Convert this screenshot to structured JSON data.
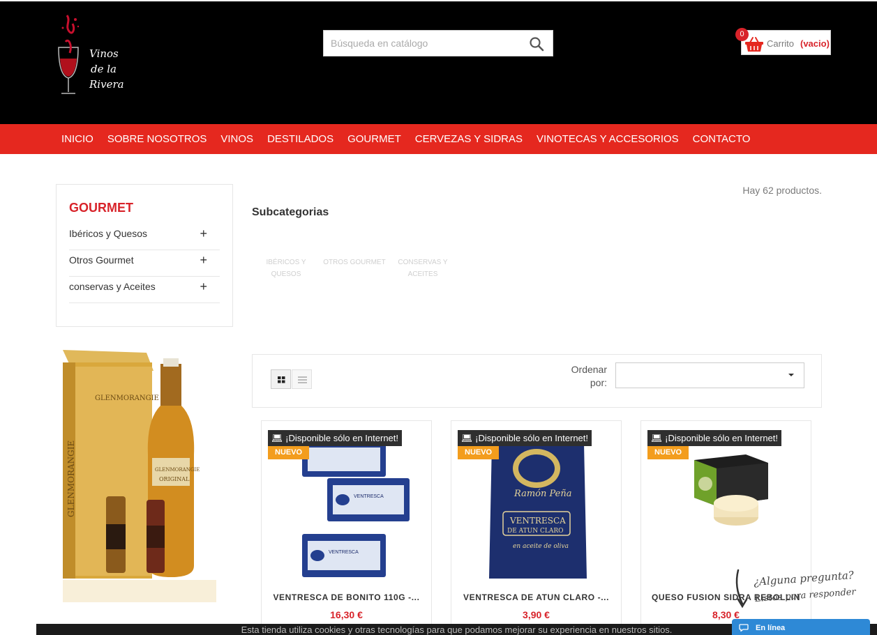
{
  "header": {
    "logo_text": "Vinos de la Rivera",
    "search_placeholder": "Búsqueda en catálogo",
    "cart": {
      "label": "Carrito",
      "status": "(vacio)",
      "count": "0"
    }
  },
  "nav": {
    "items": [
      "INICIO",
      "SOBRE NOSOTROS",
      "VINOS",
      "DESTILADOS",
      "GOURMET",
      "CERVEZAS Y SIDRAS",
      "VINOTECAS Y ACCESORIOS",
      "CONTACTO"
    ]
  },
  "sidebar": {
    "title": "GOURMET",
    "items": [
      {
        "label": "Ibéricos y Quesos",
        "toggle": "+"
      },
      {
        "label": "Otros Gourmet",
        "toggle": "+"
      },
      {
        "label": "conservas y Aceites",
        "toggle": "+"
      }
    ],
    "promo_text": "GLENMORANGIE"
  },
  "main": {
    "product_count": "Hay 62 productos.",
    "subcategories_title": "Subcategorias",
    "subcategories": [
      "IBÉRICOS Y QUESOS",
      "OTROS GOURMET",
      "CONSERVAS Y ACEITES"
    ],
    "sort_label": "Ordenar por:",
    "sort_value": ""
  },
  "products": [
    {
      "flag_online": "¡Disponible sólo en Internet!",
      "flag_new": "NUEVO",
      "name": "VENTRESCA DE BONITO 110G -...",
      "price": "16,30 €"
    },
    {
      "flag_online": "¡Disponible sólo en Internet!",
      "flag_new": "NUEVO",
      "name": "VENTRESCA DE ATUN CLARO -...",
      "price": "3,90 €"
    },
    {
      "flag_online": "¡Disponible sólo en Internet!",
      "flag_new": "NUEVO",
      "name": "QUESO FUSION SIDRA REBOLLIN",
      "price": "8,30 €"
    }
  ],
  "cookie_notice": "Esta tienda utiliza cookies y otras tecnologías para que podamos mejorar su experiencia en nuestros sitios.",
  "chat": {
    "question": "¿Alguna pregunta?",
    "subtitle": "Listos para responder",
    "status": "En línea"
  },
  "colors": {
    "brand_red": "#e5281f",
    "price_red": "#d8232a",
    "badge_orange": "#f39d1d",
    "chat_blue": "#2e89d6"
  }
}
